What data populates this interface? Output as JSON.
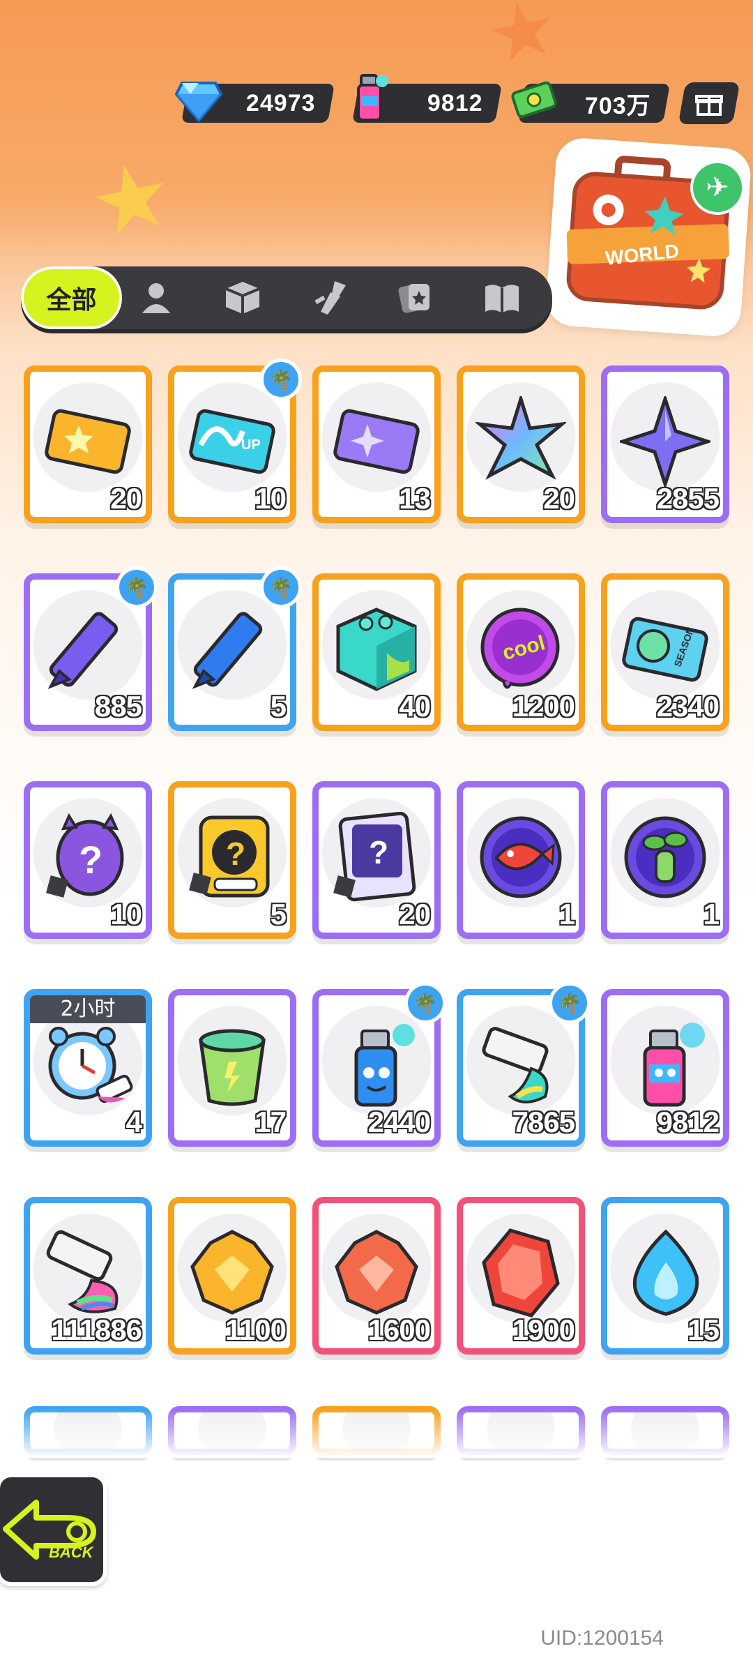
{
  "currencies": [
    {
      "name": "diamond",
      "icon": "diamond-icon",
      "value": "24973"
    },
    {
      "name": "spray",
      "icon": "spray-can-icon",
      "value": "9812"
    },
    {
      "name": "cash",
      "icon": "cash-icon",
      "value": "703万"
    }
  ],
  "tabs": {
    "active_label": "全部",
    "icons": [
      "person-icon",
      "box-icon",
      "spray-gun-icon",
      "cards-icon",
      "book-icon"
    ]
  },
  "world_card": {
    "label": "WORLD"
  },
  "items": [
    {
      "icon": "gold-ticket-icon",
      "count": "20",
      "border": "orange",
      "badge": false
    },
    {
      "icon": "wave-ticket-icon",
      "count": "10",
      "border": "orange",
      "badge": true
    },
    {
      "icon": "purple-ticket-icon",
      "count": "13",
      "border": "orange",
      "badge": false
    },
    {
      "icon": "rainbow-star-icon",
      "count": "20",
      "border": "orange",
      "badge": false
    },
    {
      "icon": "purple-star-icon",
      "count": "2855",
      "border": "purple",
      "badge": false
    },
    {
      "icon": "purple-crayon-icon",
      "count": "885",
      "border": "purple",
      "badge": true
    },
    {
      "icon": "blue-crayon-icon",
      "count": "5",
      "border": "blue",
      "badge": true
    },
    {
      "icon": "paint-cube-icon",
      "count": "40",
      "border": "orange",
      "badge": false
    },
    {
      "icon": "cool-sticker-icon",
      "count": "1200",
      "border": "orange",
      "badge": false
    },
    {
      "icon": "season-ticket-icon",
      "count": "2340",
      "border": "orange",
      "badge": false
    },
    {
      "icon": "mystery-egg-icon",
      "count": "10",
      "border": "purple",
      "badge": false
    },
    {
      "icon": "deity-mystery-icon",
      "count": "5",
      "border": "orange",
      "badge": false
    },
    {
      "icon": "travel-card-icon",
      "count": "20",
      "border": "purple",
      "badge": false
    },
    {
      "icon": "fish-token-icon",
      "count": "1",
      "border": "purple",
      "badge": false
    },
    {
      "icon": "sprout-token-icon",
      "count": "1",
      "border": "purple",
      "badge": false
    },
    {
      "icon": "alarm-clock-icon",
      "count": "4",
      "border": "blue",
      "badge": false,
      "timer": "2小时"
    },
    {
      "icon": "green-jelly-icon",
      "count": "17",
      "border": "purple",
      "badge": false
    },
    {
      "icon": "blue-spray-can-icon",
      "count": "2440",
      "border": "purple",
      "badge": true
    },
    {
      "icon": "paint-tube-icon",
      "count": "7865",
      "border": "blue",
      "badge": true
    },
    {
      "icon": "pink-spray-can-icon",
      "count": "9812",
      "border": "purple",
      "badge": false
    },
    {
      "icon": "rainbow-tube-icon",
      "count": "111886",
      "border": "blue",
      "badge": false
    },
    {
      "icon": "gold-crystal-icon",
      "count": "1100",
      "border": "orange",
      "badge": false
    },
    {
      "icon": "red-crystal-icon",
      "count": "1600",
      "border": "pink",
      "badge": false
    },
    {
      "icon": "ruby-gem-icon",
      "count": "1900",
      "border": "pink",
      "badge": false
    },
    {
      "icon": "blue-flame-icon",
      "count": "15",
      "border": "blue",
      "badge": false
    }
  ],
  "back_button": {
    "label": "BACK"
  },
  "uid": "UID:1200154",
  "colors": {
    "orange": "#f7a11d",
    "purple": "#9c6ef5",
    "blue": "#3ea4f2",
    "pink": "#f2527a",
    "active_tab": "#d6f21f",
    "dark": "#2e2e33"
  }
}
